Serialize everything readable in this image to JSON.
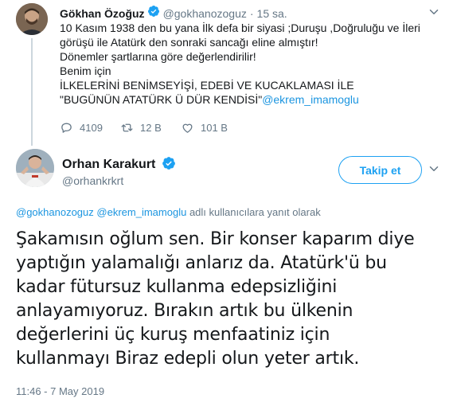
{
  "parent_tweet": {
    "name": "Gökhan Özoğuz",
    "handle": "@gokhanozoguz",
    "dot": "·",
    "time": "15 sa.",
    "lines": [
      "10 Kasım 1938 den bu yana İlk defa bir siyasi ;Duruşu ,Doğruluğu ve İleri",
      "görüşü ile Atatürk den sonraki sancağı eline almıştır!",
      "Dönemler şartlarına göre değerlendirilir!",
      "Benim için",
      "İLKELERİNİ BENİMSEYİŞİ, EDEBİ VE KUCAKLAMASI İLE"
    ],
    "last_line_text": "\"BUGÜNÜN ATATÜRK Ü DÜR KENDİSİ\"",
    "last_line_mention": "@ekrem_imamoglu",
    "actions": {
      "reply_count": "4109",
      "retweet_count": "12 B",
      "like_count": "101 B"
    }
  },
  "main_tweet": {
    "name": "Orhan Karakurt",
    "handle": "@orhankrkrt",
    "follow_label": "Takip et",
    "reply_mention_1": "@gokhanozoguz",
    "reply_mention_2": "@ekrem_imamoglu",
    "reply_suffix": "adlı kullanıcılara yanıt olarak",
    "lines": [
      "Şakamısın oğlum sen. Bir konser kaparım diye",
      "yaptığın yalamalığı anlarız da. Atatürk'ü bu",
      "kadar fütursuz kullanma edepsizliğini",
      "anlayamıyoruz. Bırakın artık bu ülkenin",
      "değerlerini üç kuruş menfaatiniz için",
      "kullanmayı Biraz edepli olun yeter artık."
    ],
    "timestamp": "11:46 - 7 May 2019"
  },
  "colors": {
    "accent": "#1da1f2",
    "mention": "#1b95e0",
    "secondary_text": "#657786",
    "primary_text": "#14171a"
  },
  "icons": [
    "verified-badge-icon",
    "chevron-down-icon",
    "reply-icon",
    "retweet-icon",
    "like-icon"
  ]
}
